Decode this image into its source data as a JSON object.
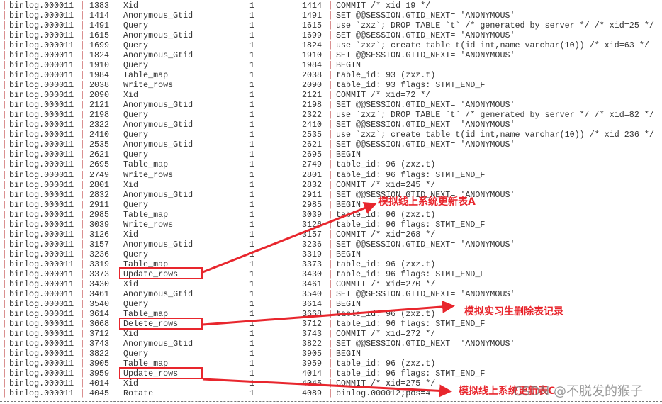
{
  "columns_note": "",
  "rows": [
    [
      "binlog.000011",
      "1383",
      "Xid",
      "1",
      "1414",
      "COMMIT /* xid=19 */"
    ],
    [
      "binlog.000011",
      "1414",
      "Anonymous_Gtid",
      "1",
      "1491",
      "SET @@SESSION.GTID_NEXT= 'ANONYMOUS'"
    ],
    [
      "binlog.000011",
      "1491",
      "Query",
      "1",
      "1615",
      "use `zxz`; DROP TABLE `t` /* generated by server */ /* xid=25 */"
    ],
    [
      "binlog.000011",
      "1615",
      "Anonymous_Gtid",
      "1",
      "1699",
      "SET @@SESSION.GTID_NEXT= 'ANONYMOUS'"
    ],
    [
      "binlog.000011",
      "1699",
      "Query",
      "1",
      "1824",
      "use `zxz`; create table t(id int,name varchar(10)) /* xid=63 */"
    ],
    [
      "binlog.000011",
      "1824",
      "Anonymous_Gtid",
      "1",
      "1910",
      "SET @@SESSION.GTID_NEXT= 'ANONYMOUS'"
    ],
    [
      "binlog.000011",
      "1910",
      "Query",
      "1",
      "1984",
      "BEGIN"
    ],
    [
      "binlog.000011",
      "1984",
      "Table_map",
      "1",
      "2038",
      "table_id: 93 (zxz.t)"
    ],
    [
      "binlog.000011",
      "2038",
      "Write_rows",
      "1",
      "2090",
      "table_id: 93 flags: STMT_END_F"
    ],
    [
      "binlog.000011",
      "2090",
      "Xid",
      "1",
      "2121",
      "COMMIT /* xid=72 */"
    ],
    [
      "binlog.000011",
      "2121",
      "Anonymous_Gtid",
      "1",
      "2198",
      "SET @@SESSION.GTID_NEXT= 'ANONYMOUS'"
    ],
    [
      "binlog.000011",
      "2198",
      "Query",
      "1",
      "2322",
      "use `zxz`; DROP TABLE `t` /* generated by server */ /* xid=82 */"
    ],
    [
      "binlog.000011",
      "2322",
      "Anonymous_Gtid",
      "1",
      "2410",
      "SET @@SESSION.GTID_NEXT= 'ANONYMOUS'"
    ],
    [
      "binlog.000011",
      "2410",
      "Query",
      "1",
      "2535",
      "use `zxz`; create table t(id int,name varchar(10)) /* xid=236 */"
    ],
    [
      "binlog.000011",
      "2535",
      "Anonymous_Gtid",
      "1",
      "2621",
      "SET @@SESSION.GTID_NEXT= 'ANONYMOUS'"
    ],
    [
      "binlog.000011",
      "2621",
      "Query",
      "1",
      "2695",
      "BEGIN"
    ],
    [
      "binlog.000011",
      "2695",
      "Table_map",
      "1",
      "2749",
      "table_id: 96 (zxz.t)"
    ],
    [
      "binlog.000011",
      "2749",
      "Write_rows",
      "1",
      "2801",
      "table_id: 96 flags: STMT_END_F"
    ],
    [
      "binlog.000011",
      "2801",
      "Xid",
      "1",
      "2832",
      "COMMIT /* xid=245 */"
    ],
    [
      "binlog.000011",
      "2832",
      "Anonymous_Gtid",
      "1",
      "2911",
      "SET @@SESSION.GTID_NEXT= 'ANONYMOUS'"
    ],
    [
      "binlog.000011",
      "2911",
      "Query",
      "1",
      "2985",
      "BEGIN"
    ],
    [
      "binlog.000011",
      "2985",
      "Table_map",
      "1",
      "3039",
      "table_id: 96 (zxz.t)"
    ],
    [
      "binlog.000011",
      "3039",
      "Write_rows",
      "1",
      "3126",
      "table_id: 96 flags: STMT_END_F"
    ],
    [
      "binlog.000011",
      "3126",
      "Xid",
      "1",
      "3157",
      "COMMIT /* xid=268 */"
    ],
    [
      "binlog.000011",
      "3157",
      "Anonymous_Gtid",
      "1",
      "3236",
      "SET @@SESSION.GTID_NEXT= 'ANONYMOUS'"
    ],
    [
      "binlog.000011",
      "3236",
      "Query",
      "1",
      "3319",
      "BEGIN"
    ],
    [
      "binlog.000011",
      "3319",
      "Table_map",
      "1",
      "3373",
      "table_id: 96 (zxz.t)"
    ],
    [
      "binlog.000011",
      "3373",
      "Update_rows",
      "1",
      "3430",
      "table_id: 96 flags: STMT_END_F"
    ],
    [
      "binlog.000011",
      "3430",
      "Xid",
      "1",
      "3461",
      "COMMIT /* xid=270 */"
    ],
    [
      "binlog.000011",
      "3461",
      "Anonymous_Gtid",
      "1",
      "3540",
      "SET @@SESSION.GTID_NEXT= 'ANONYMOUS'"
    ],
    [
      "binlog.000011",
      "3540",
      "Query",
      "1",
      "3614",
      "BEGIN"
    ],
    [
      "binlog.000011",
      "3614",
      "Table_map",
      "1",
      "3668",
      "table_id: 96 (zxz.t)"
    ],
    [
      "binlog.000011",
      "3668",
      "Delete_rows",
      "1",
      "3712",
      "table_id: 96 flags: STMT_END_F"
    ],
    [
      "binlog.000011",
      "3712",
      "Xid",
      "1",
      "3743",
      "COMMIT /* xid=272 */"
    ],
    [
      "binlog.000011",
      "3743",
      "Anonymous_Gtid",
      "1",
      "3822",
      "SET @@SESSION.GTID_NEXT= 'ANONYMOUS'"
    ],
    [
      "binlog.000011",
      "3822",
      "Query",
      "1",
      "3905",
      "BEGIN"
    ],
    [
      "binlog.000011",
      "3905",
      "Table_map",
      "1",
      "3959",
      "table_id: 96 (zxz.t)"
    ],
    [
      "binlog.000011",
      "3959",
      "Update_rows",
      "1",
      "4014",
      "table_id: 96 flags: STMT_END_F"
    ],
    [
      "binlog.000011",
      "4014",
      "Xid",
      "1",
      "4045",
      "COMMIT /* xid=275 */"
    ],
    [
      "binlog.000011",
      "4045",
      "Rotate",
      "1",
      "4089",
      "binlog.000012;pos=4"
    ]
  ],
  "annotations": {
    "a": "模拟线上系统更新表A",
    "b": "模拟实习生删除表记录",
    "c": "模拟线上系统更新表C"
  },
  "watermark": "CSDN @不脱发的猴子",
  "colors": {
    "annotation": "#e8262d",
    "pipe": "#d98a8a",
    "text": "#333333"
  }
}
